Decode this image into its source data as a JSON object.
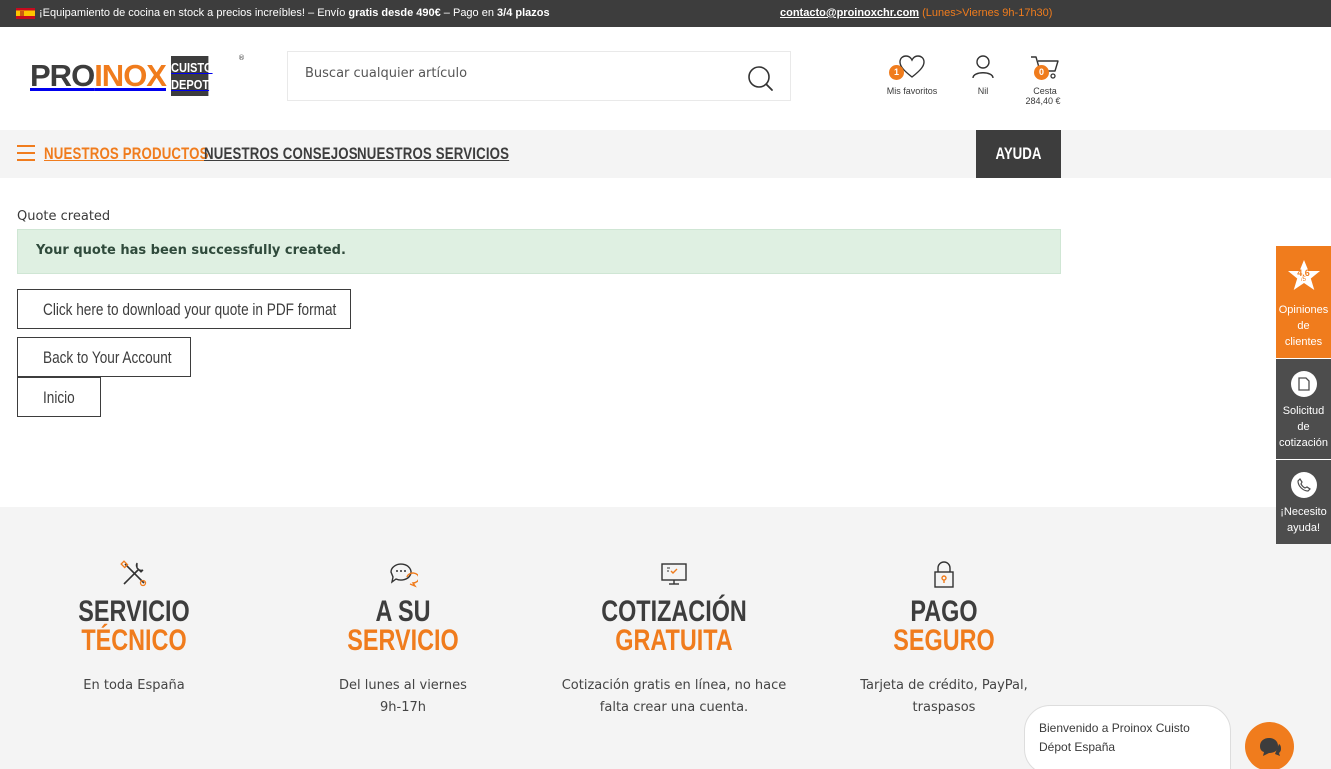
{
  "topbar": {
    "promo_prefix": "¡Equipamiento de cocina en stock a precios increíbles! – Envío ",
    "promo_bold1": "gratis desde 490€",
    "promo_mid": " – Pago en ",
    "promo_bold2": "3/4 plazos",
    "email": "contacto@proinoxchr.com",
    "hours": "(Lunes>Viernes 9h-17h30)"
  },
  "logo": {
    "part1": "PRO",
    "part2": "INOX",
    "badge_line1": "CUISTO",
    "badge_line2": "DEPOT",
    "reg": "®"
  },
  "search": {
    "placeholder": "Buscar cualquier artículo"
  },
  "header_icons": {
    "favorites_label": "Mis favoritos",
    "favorites_count": "1",
    "account_label": "Nil",
    "cart_label": "Cesta",
    "cart_count": "0",
    "cart_total": "284,40 €"
  },
  "nav": {
    "products": "NUESTROS PRODUCTOS",
    "tips": "NUESTROS CONSEJOS",
    "services": "NUESTROS SERVICIOS",
    "help": "AYUDA"
  },
  "main": {
    "breadcrumb": "Quote created",
    "alert": "Your quote has been successfully created.",
    "btn_download": "Click here to download your quote in PDF format",
    "btn_account": "Back to Your Account",
    "btn_home": "Inicio"
  },
  "features": [
    {
      "t1": "SERVICIO",
      "t2": "TÉCNICO",
      "desc1": "En toda España",
      "desc2": ""
    },
    {
      "t1": "A SU",
      "t2": "SERVICIO",
      "desc1": "Del lunes al viernes",
      "desc2": "9h-17h"
    },
    {
      "t1": "COTIZACIÓN",
      "t2": "GRATUITA",
      "desc1": "Cotización gratis en línea, no hace",
      "desc2": "falta crear una cuenta."
    },
    {
      "t1": "PAGO",
      "t2": "SEGURO",
      "desc1": "Tarjeta de crédito, PayPal,",
      "desc2": "traspasos"
    }
  ],
  "side": {
    "rating": "4.6",
    "rating_sub": "/5",
    "reviews_l1": "Opiniones",
    "reviews_l2": "de",
    "reviews_l3": "clientes",
    "quote_l1": "Solicitud",
    "quote_l2": "de",
    "quote_l3": "cotización",
    "help_l1": "¡Necesito",
    "help_l2": "ayuda!"
  },
  "chat": {
    "welcome": "Bienvenido a Proinox Cuisto Dépot España"
  },
  "colors": {
    "accent": "#f07c1d",
    "dark": "#3d3d3d",
    "success_bg": "#dff0e2"
  }
}
